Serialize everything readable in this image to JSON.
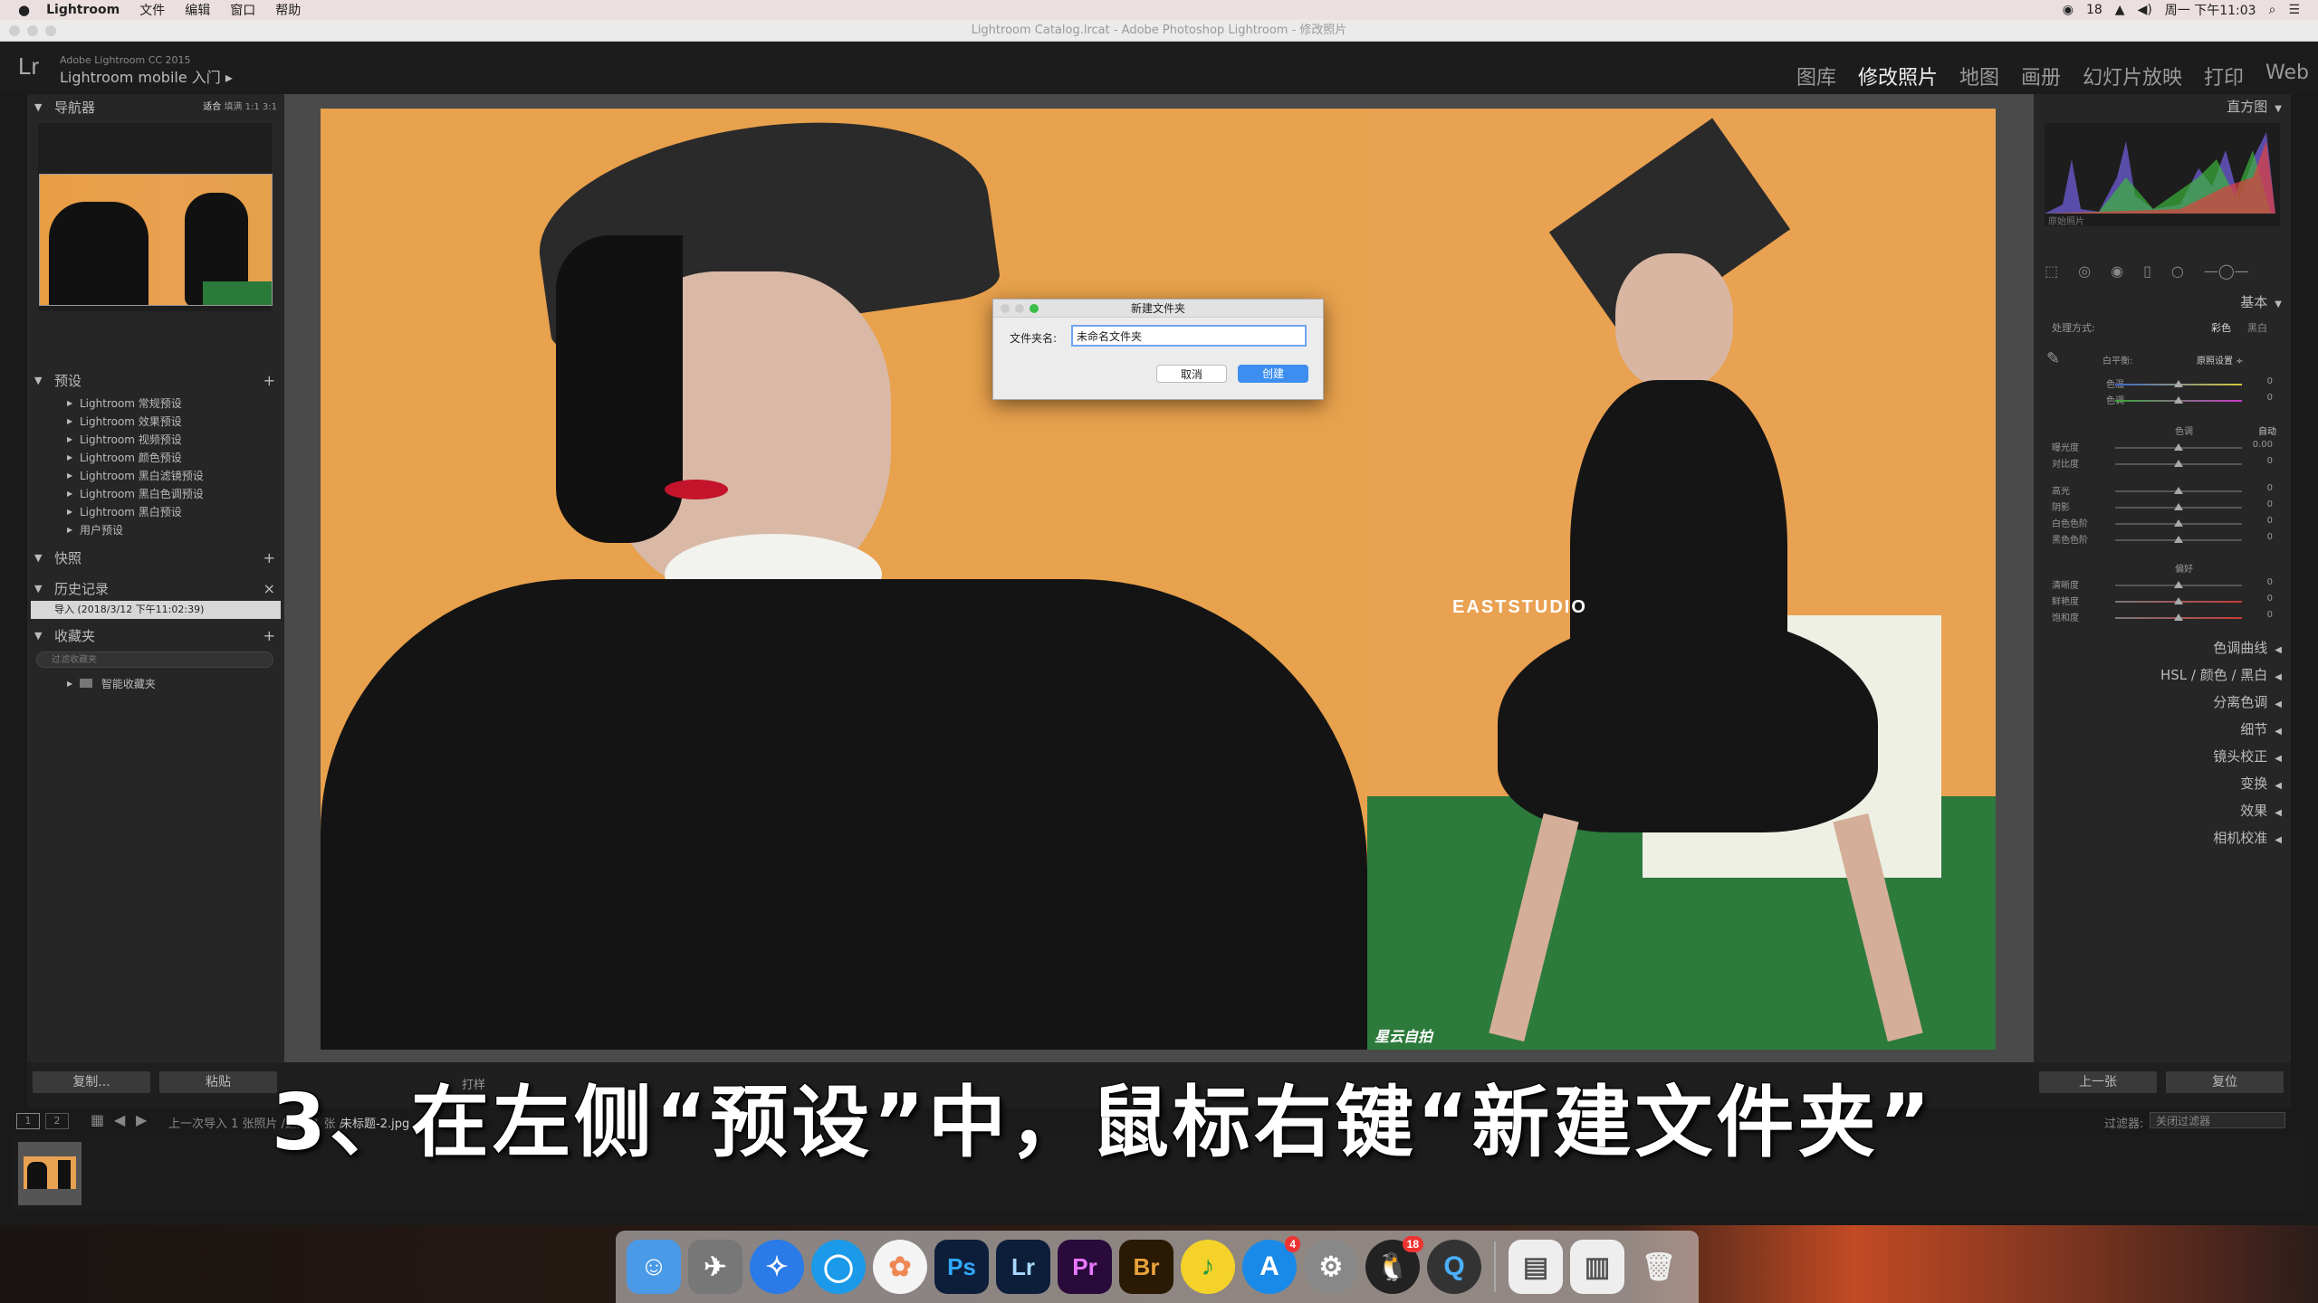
{
  "menubar": {
    "app": "Lightroom",
    "items": [
      "文件",
      "编辑",
      "窗口",
      "帮助"
    ],
    "status_count": "18",
    "datetime": "周一 下午11:03"
  },
  "window": {
    "title": "Lightroom Catalog.lrcat - Adobe Photoshop Lightroom - 修改照片"
  },
  "lr": {
    "logo": "Lr",
    "version": "Adobe Lightroom CC 2015",
    "mobile": "Lightroom mobile 入门 ▸"
  },
  "modules": [
    "图库",
    "修改照片",
    "地图",
    "画册",
    "幻灯片放映",
    "打印",
    "Web"
  ],
  "left": {
    "navigator": {
      "title": "导航器",
      "zoom": [
        "适合",
        "填满",
        "1:1",
        "3:1"
      ]
    },
    "presets": {
      "title": "预设",
      "items": [
        "Lightroom 常规预设",
        "Lightroom 效果预设",
        "Lightroom 视频预设",
        "Lightroom 颜色预设",
        "Lightroom 黑白滤镜预设",
        "Lightroom 黑白色调预设",
        "Lightroom 黑白预设",
        "用户预设"
      ]
    },
    "snapshots": {
      "title": "快照"
    },
    "history": {
      "title": "历史记录",
      "entry": "导入 (2018/3/12 下午11:02:39)"
    },
    "collections": {
      "title": "收藏夹",
      "search_placeholder": "过滤收藏夹",
      "smart": "智能收藏夹"
    },
    "copy_btn": "复制...",
    "paste_btn": "粘贴"
  },
  "photo": {
    "watermark": "EASTSTUDIO",
    "corner": "星云自拍"
  },
  "dialog": {
    "title": "新建文件夹",
    "label": "文件夹名:",
    "value": "未命名文件夹",
    "cancel": "取消",
    "create": "创建"
  },
  "right": {
    "histogram": "直方图",
    "original": "原始照片",
    "basic": "基本",
    "treatment_label": "处理方式:",
    "color": "彩色",
    "bw": "黑白",
    "wb_label": "白平衡:",
    "wb_value": "原照设置 ÷",
    "temp": "色温",
    "tint": "色调",
    "tone": "色调",
    "auto": "自动",
    "exposure": "曝光度",
    "exposure_val": "0.00",
    "contrast": "对比度",
    "highlights": "高光",
    "shadows": "阴影",
    "whites": "白色色阶",
    "blacks": "黑色色阶",
    "presence": "偏好",
    "clarity": "清晰度",
    "vibrance": "鲜艳度",
    "saturation": "饱和度",
    "zero": "0",
    "sections": [
      "色调曲线",
      "HSL / 颜色 / 黑白",
      "分离色调",
      "细节",
      "镜头校正",
      "变换",
      "效果",
      "相机校准"
    ],
    "prev_btn": "上一张",
    "reset_btn": "复位"
  },
  "filmstrip": {
    "pages": [
      "1",
      "2"
    ],
    "info": "上一次导入  1 张照片 /选定 1 张 /",
    "file": "未标题-2.jpg",
    "filter_label": "过滤器:",
    "filter_value": "关闭过滤器"
  },
  "toolbar": {
    "softproof": "打样"
  },
  "subtitle": "3、在左侧“预设”中，鼠标右键“新建文件夹”",
  "dock": [
    "Finder",
    "Launchpad",
    "Safari",
    "QuickTime",
    "Photos",
    "Ps",
    "Lr",
    "Pr",
    "Br",
    "Music",
    "App Store",
    "System Preferences",
    "QQ",
    "Q",
    "Preview",
    "Docs",
    "Trash"
  ],
  "dock_badges": {
    "appstore": "4",
    "qq": "18"
  }
}
